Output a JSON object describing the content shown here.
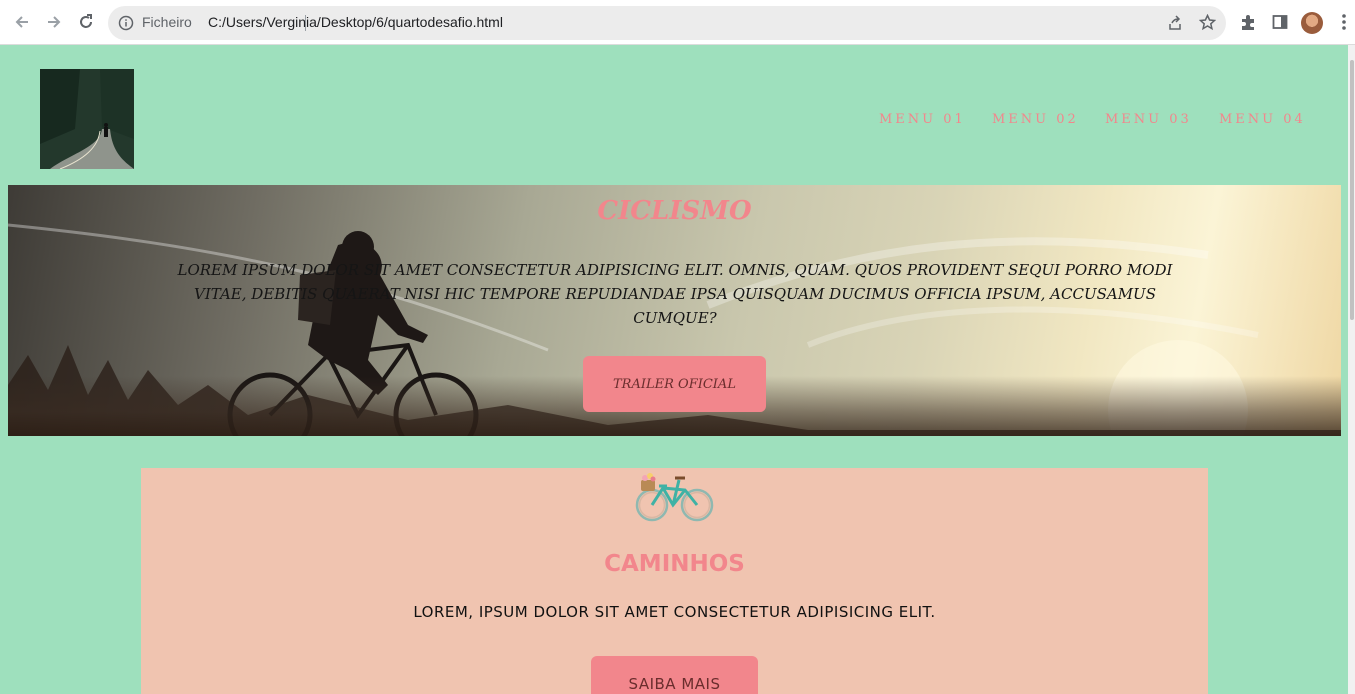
{
  "browser": {
    "address_scheme": "Ficheiro",
    "address_url": "C:/Users/Verginia/Desktop/6/quartodesafio.html",
    "icons": [
      "back-icon",
      "forward-icon",
      "reload-icon",
      "info-icon",
      "share-icon",
      "star-icon",
      "extensions-icon",
      "side-panel-icon",
      "profile-avatar",
      "more-icon"
    ]
  },
  "header": {
    "logo_icon": "cyclist-road-photo",
    "menu": [
      "MENU 01",
      "MENU 02",
      "MENU 03",
      "MENU 04"
    ]
  },
  "hero": {
    "title": "CICLISMO",
    "text": "LOREM IPSUM DOLOR SIT AMET CONSECTETUR ADIPISICING ELIT. OMNIS, QUAM. QUOS PROVIDENT SEQUI PORRO MODI VITAE, DEBITIS QUAERAT NISI HIC TEMPORE REPUDIANDAE IPSA QUISQUAM DUCIMUS OFFICIA IPSUM, ACCUSAMUS CUMQUE?",
    "button_label": "TRAILER OFICIAL",
    "background": "cyclist-sunset-photo"
  },
  "card": {
    "icon": "bicycle-icon",
    "title": "CAMINHOS",
    "text": "LOREM, IPSUM DOLOR SIT AMET CONSECTETUR ADIPISICING ELIT.",
    "button_label": "SAIBA MAIS"
  },
  "colors": {
    "page_bg": "#9ee0bd",
    "accent": "#f2868c",
    "card_bg": "#f0c4b0"
  }
}
